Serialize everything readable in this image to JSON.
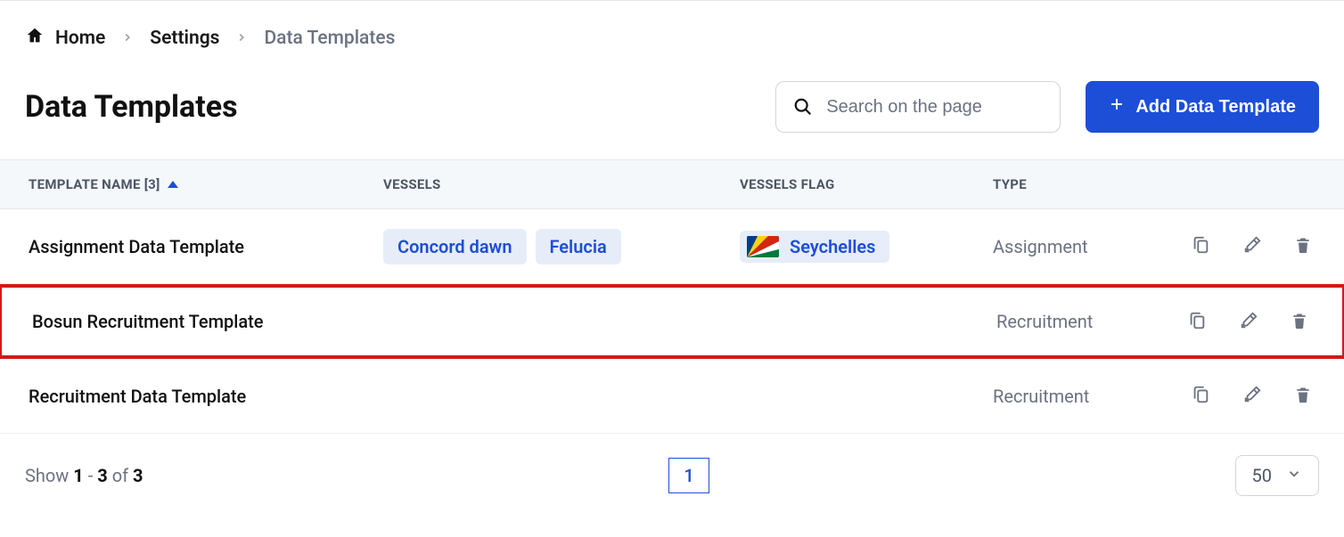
{
  "breadcrumb": {
    "home": "Home",
    "settings": "Settings",
    "current": "Data Templates"
  },
  "page": {
    "title": "Data Templates",
    "search_placeholder": "Search on the page",
    "add_button": "Add Data Template"
  },
  "table": {
    "headers": {
      "name": "TEMPLATE NAME [3]",
      "vessels": "VESSELS",
      "flag": "VESSELS FLAG",
      "type": "TYPE"
    },
    "rows": [
      {
        "name": "Assignment Data Template",
        "vessels": [
          "Concord dawn",
          "Felucia"
        ],
        "flag": "Seychelles",
        "type": "Assignment",
        "highlight": false
      },
      {
        "name": "Bosun Recruitment Template",
        "vessels": [],
        "flag": "",
        "type": "Recruitment",
        "highlight": true
      },
      {
        "name": "Recruitment Data Template",
        "vessels": [],
        "flag": "",
        "type": "Recruitment",
        "highlight": false
      }
    ]
  },
  "footer": {
    "show": "Show",
    "range_from": "1",
    "range_to": "3",
    "of": "of",
    "total": "3",
    "page_current": "1",
    "page_size": "50"
  }
}
